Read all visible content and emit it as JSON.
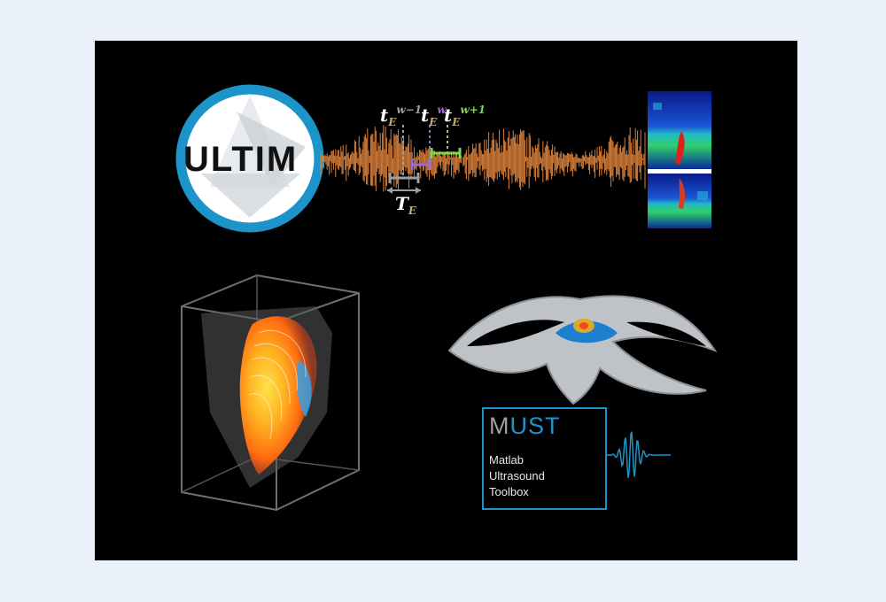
{
  "logo": {
    "text": "ULTIM",
    "ring_color": "#1c93c9",
    "icon": "ultim-logo-icon"
  },
  "signal": {
    "color": "#d9803a",
    "labels": {
      "t_prev": {
        "main": "t",
        "sub": "E",
        "sup": "w−1",
        "color": "#9aa0a6"
      },
      "t_cur": {
        "main": "t",
        "sub": "E",
        "sup": "w",
        "color": "#a06ad6"
      },
      "t_next": {
        "main": "t",
        "sub": "E",
        "sup": "w+1",
        "color": "#7fd650"
      },
      "T_E": {
        "main": "T",
        "sub": "E",
        "color": "#9aa0a6"
      }
    },
    "label_letter_colors": {
      "t": "#ffffff",
      "E": "#c9a86a"
    }
  },
  "must": {
    "title_m": "M",
    "title_ust": "UST",
    "line1": "Matlab",
    "line2": "Ultrasound",
    "line3": "Toolbox",
    "border_color": "#1c93c9"
  },
  "images": {
    "doppler": "doppler-spectrogram-icon",
    "heart": "heart-flow-volume-icon",
    "vessel": "vessel-bifurcation-render-icon",
    "beam": "beam-profile-icon",
    "waveform": "echo-waveform-icon"
  }
}
